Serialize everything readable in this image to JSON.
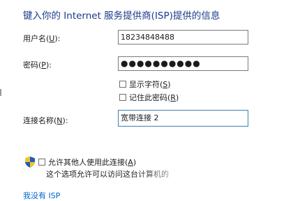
{
  "heading": "键入你的 Internet 服务提供商(ISP)提供的信息",
  "username": {
    "label_pre": "用户名(",
    "accel": "U",
    "label_post": "):",
    "value": "18234848488"
  },
  "password": {
    "label_pre": "密码(",
    "accel": "P",
    "label_post": "):",
    "masked_value": "●●●●●●●●●●"
  },
  "show_chars": {
    "label_pre": "显示字符(",
    "accel": "S",
    "label_post": ")"
  },
  "remember": {
    "label_pre": "记住此密码(",
    "accel": "R",
    "label_post": ")"
  },
  "connection_name": {
    "label_pre": "连接名称(",
    "accel": "N",
    "label_post": "):",
    "value": "宽带连接 2"
  },
  "allow_others": {
    "label_pre": "允许其他人使用此连接(",
    "accel": "A",
    "label_post": ")",
    "description": "这个选项允许可以访问这台计算机的"
  },
  "no_isp_link": "我没有 ISP",
  "colors": {
    "heading": "#1a3a8a",
    "link": "#0066cc",
    "focus_border": "#3c7fb1"
  }
}
